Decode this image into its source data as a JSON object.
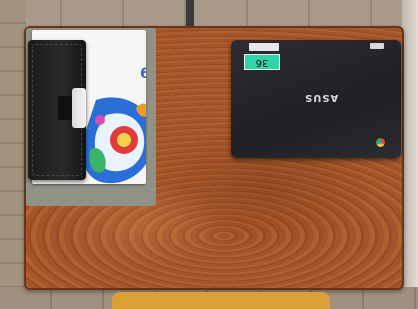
{
  "scene": {
    "description_tags": [
      "desk",
      "notebook",
      "planner",
      "laptop"
    ],
    "colors": {
      "desk_wood": "#a55a2c",
      "mat": "#8f978d",
      "laptop_body": "#2b2d31",
      "label_green": "#2fd4a8",
      "chair": "#d9a035"
    }
  },
  "notebook": {
    "cover_number": "6"
  },
  "laptop": {
    "label_text": "36",
    "brand_text": "ASUS",
    "sticker_icon": "chrome-icon"
  }
}
